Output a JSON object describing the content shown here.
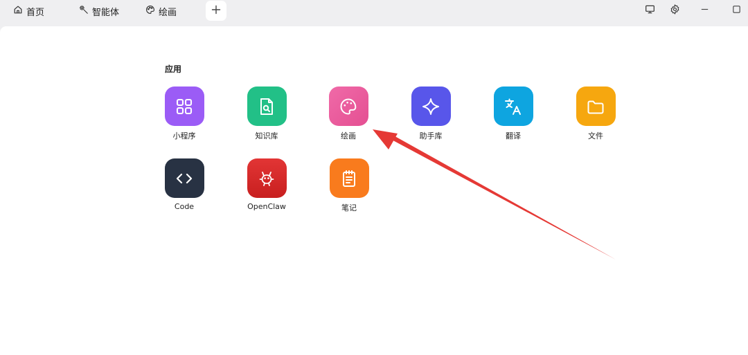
{
  "tabs": [
    {
      "label": "首页",
      "icon": "home-icon"
    },
    {
      "label": "智能体",
      "icon": "magic-wand-icon"
    },
    {
      "label": "绘画",
      "icon": "palette-icon"
    }
  ],
  "window_controls": [
    "monitor-icon",
    "gear-icon",
    "minimize-icon",
    "maximize-icon"
  ],
  "section_title": "应用",
  "apps": [
    {
      "label": "小程序",
      "icon": "grid-icon",
      "color": "#9b5cf6"
    },
    {
      "label": "知识库",
      "icon": "document-search-icon",
      "color": "#22c087"
    },
    {
      "label": "绘画",
      "icon": "palette-icon",
      "color": "#ec5ca0"
    },
    {
      "label": "助手库",
      "icon": "sparkle-icon",
      "color": "#5856ea"
    },
    {
      "label": "翻译",
      "icon": "translate-icon",
      "color": "#0ea5e0"
    },
    {
      "label": "文件",
      "icon": "folder-icon",
      "color": "#f6a70f"
    },
    {
      "label": "Code",
      "icon": "code-icon",
      "color": "#283243"
    },
    {
      "label": "OpenClaw",
      "icon": "claw-icon",
      "color": "#d62c2c"
    },
    {
      "label": "笔记",
      "icon": "notepad-icon",
      "color": "#f97b1d"
    }
  ],
  "annotation_arrow_color": "#e53935"
}
